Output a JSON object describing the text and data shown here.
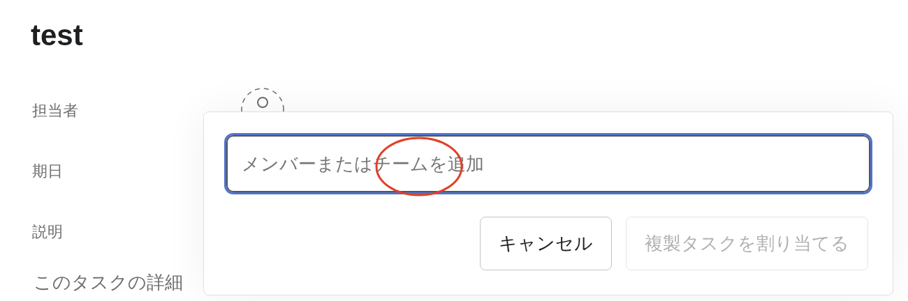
{
  "task": {
    "title": "test"
  },
  "fields": [
    {
      "label": "担当者"
    },
    {
      "label": "期日"
    },
    {
      "label": "説明"
    }
  ],
  "description": {
    "placeholder": "このタスクの詳細"
  },
  "popover": {
    "search": {
      "placeholder": "メンバーまたはチームを追加"
    },
    "buttons": [
      {
        "label": "キャンセル",
        "disabled": false
      },
      {
        "label": "複製タスクを割り当てる",
        "disabled": true
      }
    ]
  }
}
